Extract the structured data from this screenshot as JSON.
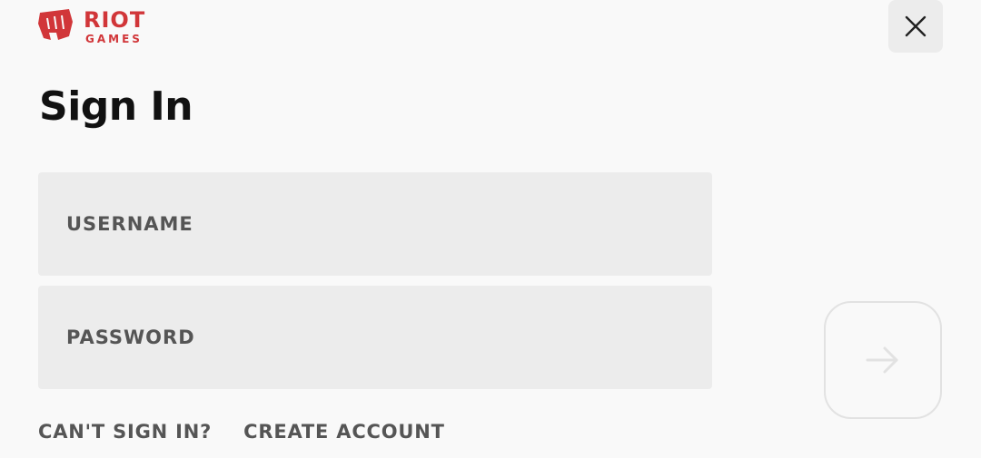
{
  "brand": {
    "name_line1": "RIOT",
    "name_line2": "GAMES",
    "color": "#d13639",
    "icon": "riot-fist-icon"
  },
  "header": {
    "close_icon": "close-icon"
  },
  "title": "Sign In",
  "form": {
    "username_placeholder": "USERNAME",
    "password_placeholder": "PASSWORD",
    "submit_icon": "arrow-right-icon"
  },
  "links": {
    "cant_sign_in": "CAN'T SIGN IN?",
    "create_account": "CREATE ACCOUNT"
  },
  "colors": {
    "background": "#f9f9f9",
    "field_background": "#ececec",
    "link_text": "#555555",
    "submit_disabled": "#e2e2e2"
  }
}
